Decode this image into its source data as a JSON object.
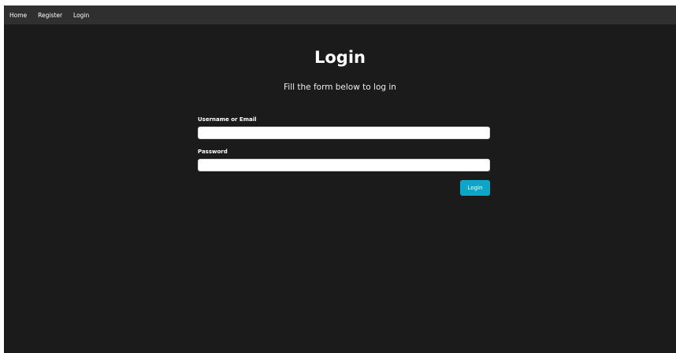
{
  "nav": {
    "items": [
      {
        "label": "Home"
      },
      {
        "label": "Register"
      },
      {
        "label": "Login"
      }
    ]
  },
  "page": {
    "title": "Login",
    "subtitle": "Fill the form below to log in"
  },
  "form": {
    "username": {
      "label": "Username or Email",
      "value": "",
      "placeholder": ""
    },
    "password": {
      "label": "Password",
      "value": "",
      "placeholder": ""
    },
    "submit_label": "Login"
  },
  "colors": {
    "background": "#1b1b1b",
    "navbar": "#2f2f2f",
    "accent": "#0ea5c6"
  }
}
